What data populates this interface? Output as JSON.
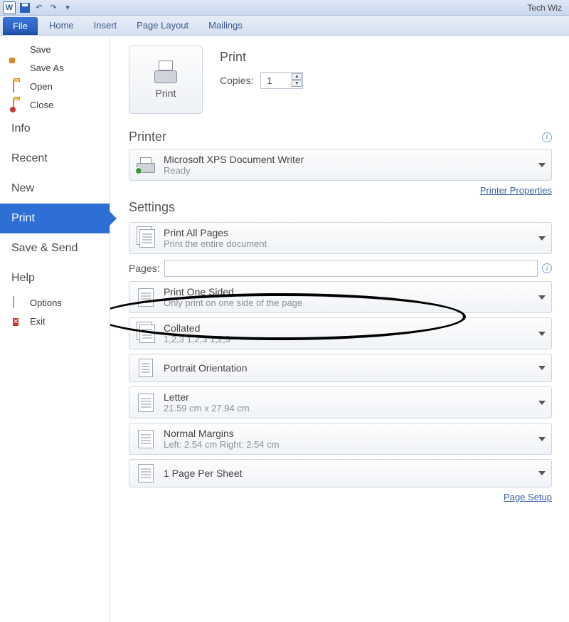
{
  "titlebar": {
    "app_badge": "W",
    "doc_title": "Tech Wiz"
  },
  "qat": {
    "save": "save-icon",
    "undo": "↶",
    "redo": "↷",
    "more": "▾"
  },
  "ribbon": {
    "file": "File",
    "tabs": [
      "Home",
      "Insert",
      "Page Layout",
      "Mailings"
    ]
  },
  "nav": {
    "small_top": [
      {
        "key": "save",
        "label": "Save"
      },
      {
        "key": "saveas",
        "label": "Save As"
      },
      {
        "key": "open",
        "label": "Open"
      },
      {
        "key": "close",
        "label": "Close"
      }
    ],
    "big": [
      {
        "key": "info",
        "label": "Info",
        "selected": false
      },
      {
        "key": "recent",
        "label": "Recent",
        "selected": false
      },
      {
        "key": "new",
        "label": "New",
        "selected": false
      },
      {
        "key": "print",
        "label": "Print",
        "selected": true
      },
      {
        "key": "share",
        "label": "Save & Send",
        "selected": false
      },
      {
        "key": "help",
        "label": "Help",
        "selected": false
      }
    ],
    "small_bottom": [
      {
        "key": "options",
        "label": "Options"
      },
      {
        "key": "exit",
        "label": "Exit"
      }
    ]
  },
  "print": {
    "button_label": "Print",
    "heading": "Print",
    "copies_label": "Copies:",
    "copies_value": "1"
  },
  "printer": {
    "heading": "Printer",
    "name": "Microsoft XPS Document Writer",
    "status": "Ready",
    "properties_link": "Printer Properties"
  },
  "settings": {
    "heading": "Settings",
    "pages_label": "Pages:",
    "pages_value": "",
    "page_setup_link": "Page Setup",
    "items": [
      {
        "title": "Print All Pages",
        "sub": "Print the entire document"
      },
      {
        "title": "Print One Sided",
        "sub": "Only print on one side of the page"
      },
      {
        "title": "Collated",
        "sub": "1,2,3    1,2,3    1,2,3"
      },
      {
        "title": "Portrait Orientation",
        "sub": ""
      },
      {
        "title": "Letter",
        "sub": "21.59 cm x 27.94 cm"
      },
      {
        "title": "Normal Margins",
        "sub": "Left:  2.54 cm    Right:  2.54 cm"
      },
      {
        "title": "1 Page Per Sheet",
        "sub": ""
      }
    ]
  },
  "annotation": {
    "highlight": "print-one-sided-ellipse"
  }
}
